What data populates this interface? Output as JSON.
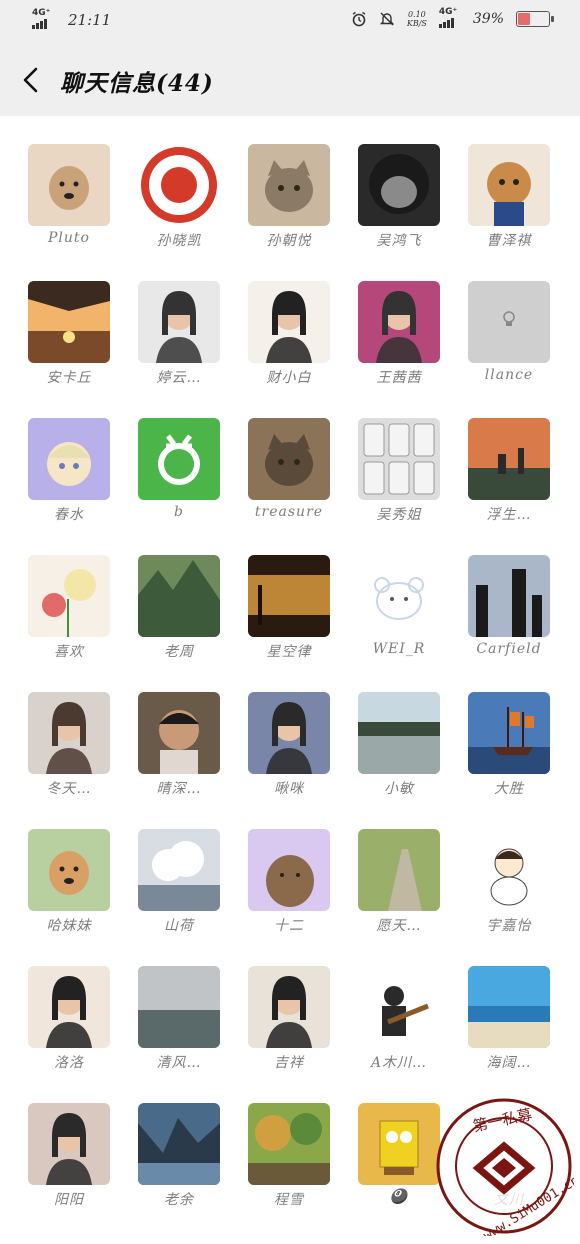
{
  "status_bar": {
    "network_left": "4G⁺",
    "time": "21:11",
    "speed": "0.10",
    "speed_unit": "KB/S",
    "network_right": "4G⁺",
    "battery": "39%",
    "battery_level": 0.39,
    "icons": [
      "signal-icon",
      "alarm-icon",
      "mute-icon",
      "signal-icon",
      "battery-icon"
    ]
  },
  "header": {
    "back_icon": "chevron-left-icon",
    "title": "聊天信息(44)"
  },
  "members": [
    {
      "name": "Pluto"
    },
    {
      "name": "孙晓凯"
    },
    {
      "name": "孙朝悦"
    },
    {
      "name": "吴鸿飞"
    },
    {
      "name": "曹泽祺"
    },
    {
      "name": "安卡丘"
    },
    {
      "name": "婷云…"
    },
    {
      "name": "财小白"
    },
    {
      "name": "王茜茜"
    },
    {
      "name": "llance"
    },
    {
      "name": "春水"
    },
    {
      "name": "b"
    },
    {
      "name": "treasure"
    },
    {
      "name": "吴秀姐"
    },
    {
      "name": "浮生…"
    },
    {
      "name": "喜欢"
    },
    {
      "name": "老周"
    },
    {
      "name": "星空律"
    },
    {
      "name": "WEI_R"
    },
    {
      "name": "Carfield"
    },
    {
      "name": "冬天…"
    },
    {
      "name": "晴深…"
    },
    {
      "name": "啾咪"
    },
    {
      "name": "小敏"
    },
    {
      "name": "大胜"
    },
    {
      "name": "哈妹妹"
    },
    {
      "name": "山荷"
    },
    {
      "name": "十二"
    },
    {
      "name": "愿天…"
    },
    {
      "name": "宇嘉怡"
    },
    {
      "name": "洛洛"
    },
    {
      "name": "清风…"
    },
    {
      "name": "吉祥"
    },
    {
      "name": "A木川…"
    },
    {
      "name": "海阔…"
    },
    {
      "name": "阳阳"
    },
    {
      "name": "老余"
    },
    {
      "name": "程雪"
    },
    {
      "name": "🎱"
    },
    {
      "name": "文川"
    }
  ],
  "watermark": {
    "text_top": "第一私募",
    "text_url": "www.SiMu001.cn"
  }
}
